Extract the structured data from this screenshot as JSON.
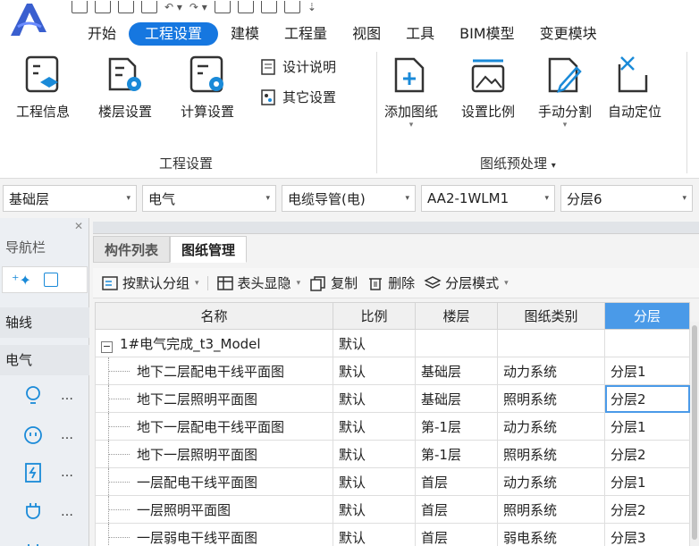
{
  "menu": {
    "items": [
      {
        "label": "开始",
        "active": false
      },
      {
        "label": "工程设置",
        "active": true
      },
      {
        "label": "建模",
        "active": false
      },
      {
        "label": "工程量",
        "active": false
      },
      {
        "label": "视图",
        "active": false
      },
      {
        "label": "工具",
        "active": false
      },
      {
        "label": "BIM模型",
        "active": false
      },
      {
        "label": "变更模块",
        "active": false
      }
    ]
  },
  "ribbon": {
    "project_group": {
      "title": "工程设置",
      "project_info": "工程信息",
      "floor_settings": "楼层设置",
      "calc_settings": "计算设置",
      "design_notes": "设计说明",
      "other_settings": "其它设置"
    },
    "drawing_group": {
      "title": "图纸预处理",
      "add_drawing": "添加图纸",
      "set_scale": "设置比例",
      "manual_split": "手动分割",
      "auto_locate": "自动定位"
    }
  },
  "combos": [
    "基础层",
    "电气",
    "电缆导管(电)",
    "AA2-1WLM1",
    "分层6"
  ],
  "nav": {
    "title": "导航栏",
    "sections": [
      "轴线",
      "电气"
    ]
  },
  "tabs": [
    {
      "label": "构件列表",
      "active": false
    },
    {
      "label": "图纸管理",
      "active": true
    }
  ],
  "toolbar": {
    "group_default": "按默认分组",
    "header_toggle": "表头显隐",
    "copy": "复制",
    "delete": "删除",
    "layer_mode": "分层模式"
  },
  "table": {
    "columns": [
      "名称",
      "比例",
      "楼层",
      "图纸类别",
      "分层"
    ],
    "group": {
      "name": "1#电气完成_t3_Model",
      "scale": "默认"
    },
    "rows": [
      {
        "name": "地下二层配电干线平面图",
        "scale": "默认",
        "floor": "基础层",
        "category": "动力系统",
        "layer": "分层1"
      },
      {
        "name": "地下二层照明平面图",
        "scale": "默认",
        "floor": "基础层",
        "category": "照明系统",
        "layer": "分层2"
      },
      {
        "name": "地下一层配电干线平面图",
        "scale": "默认",
        "floor": "第-1层",
        "category": "动力系统",
        "layer": "分层1"
      },
      {
        "name": "地下一层照明平面图",
        "scale": "默认",
        "floor": "第-1层",
        "category": "照明系统",
        "layer": "分层2"
      },
      {
        "name": "一层配电干线平面图",
        "scale": "默认",
        "floor": "首层",
        "category": "动力系统",
        "layer": "分层1"
      },
      {
        "name": "一层照明平面图",
        "scale": "默认",
        "floor": "首层",
        "category": "照明系统",
        "layer": "分层2"
      },
      {
        "name": "一层弱电干线平面图",
        "scale": "默认",
        "floor": "首层",
        "category": "弱电系统",
        "layer": "分层3"
      }
    ]
  },
  "colors": {
    "accent": "#1677e0",
    "selected_header": "#4a9ae8"
  }
}
